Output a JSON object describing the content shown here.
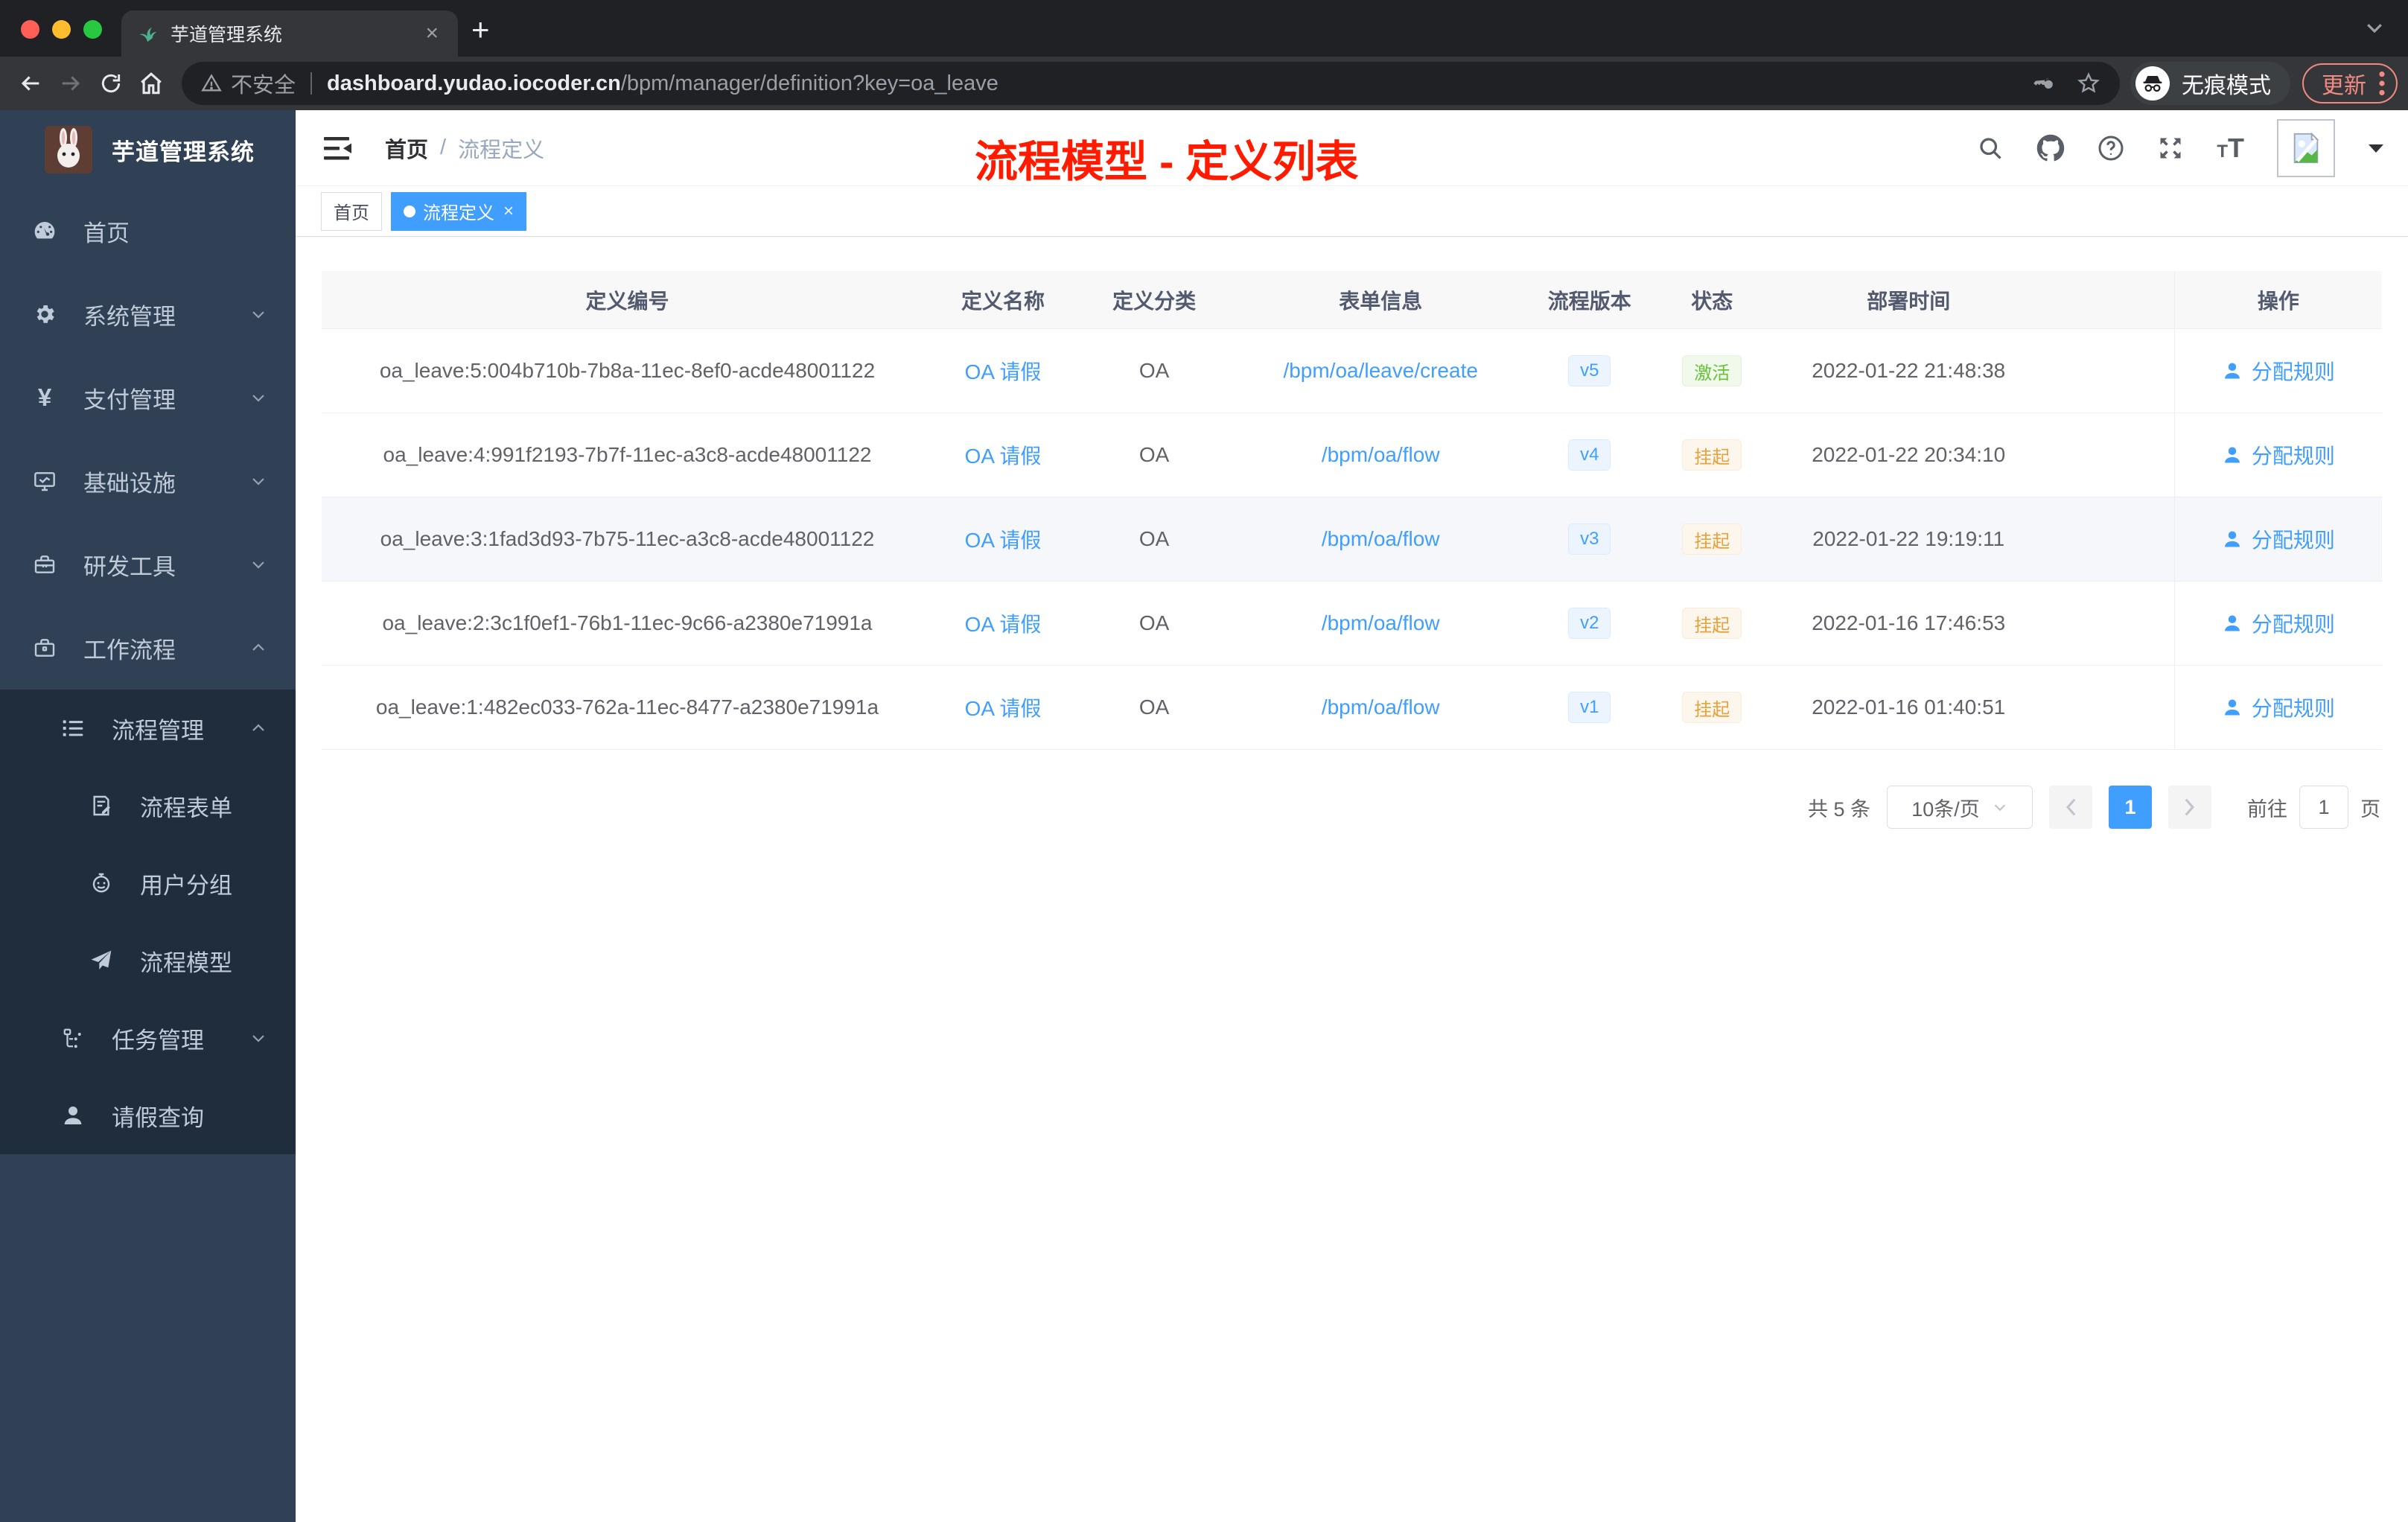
{
  "browser": {
    "tab_title": "芋道管理系统",
    "tab_close": "×",
    "new_tab": "+",
    "security_label": "不安全",
    "url_domain": "dashboard.yudao.iocoder.cn",
    "url_path": "/bpm/manager/definition?key=oa_leave",
    "incognito_label": "无痕模式",
    "update_label": "更新"
  },
  "sidebar": {
    "logo_title": "芋道管理系统",
    "menu": [
      {
        "key": "home",
        "label": "首页",
        "icon": "dashboard-icon",
        "level": 1
      },
      {
        "key": "system-mgmt",
        "label": "系统管理",
        "icon": "gear-icon",
        "level": 1,
        "chevron": "down"
      },
      {
        "key": "payment-mgmt",
        "label": "支付管理",
        "icon": "yen-icon",
        "level": 1,
        "chevron": "down"
      },
      {
        "key": "infrastructure",
        "label": "基础设施",
        "icon": "monitor-icon",
        "level": 1,
        "chevron": "down"
      },
      {
        "key": "dev-tools",
        "label": "研发工具",
        "icon": "toolbox-icon",
        "level": 1,
        "chevron": "down"
      },
      {
        "key": "workflow",
        "label": "工作流程",
        "icon": "briefcase-icon",
        "level": 1,
        "chevron": "up"
      }
    ],
    "submenu": [
      {
        "key": "process-mgmt",
        "label": "流程管理",
        "icon": "list-icon",
        "level": 2,
        "chevron": "up"
      },
      {
        "key": "process-form",
        "label": "流程表单",
        "icon": "form-icon",
        "level": 3
      },
      {
        "key": "user-group",
        "label": "用户分组",
        "icon": "robot-icon",
        "level": 3
      },
      {
        "key": "process-model",
        "label": "流程模型",
        "icon": "paper-plane-icon",
        "level": 3
      },
      {
        "key": "task-mgmt",
        "label": "任务管理",
        "icon": "tree-icon",
        "level": 2,
        "chevron": "down"
      },
      {
        "key": "leave-query",
        "label": "请假查询",
        "icon": "user-icon",
        "level": 2
      }
    ]
  },
  "header": {
    "breadcrumb": [
      "首页",
      "流程定义"
    ],
    "separator": "/",
    "annotation": "流程模型 - 定义列表"
  },
  "tags": [
    {
      "key": "home",
      "label": "首页",
      "active": false,
      "closable": false
    },
    {
      "key": "process-definition",
      "label": "流程定义",
      "active": true,
      "closable": true
    }
  ],
  "table": {
    "columns": [
      "定义编号",
      "定义名称",
      "定义分类",
      "表单信息",
      "流程版本",
      "状态",
      "部署时间",
      "操作"
    ],
    "rows": [
      {
        "id": "oa_leave:5:004b710b-7b8a-11ec-8ef0-acde48001122",
        "name": "OA 请假",
        "category": "OA",
        "form": "/bpm/oa/leave/create",
        "version": "v5",
        "status": "激活",
        "status_type": "success",
        "deploy_time": "2022-01-22 21:48:38",
        "action": "分配规则",
        "highlighted": false
      },
      {
        "id": "oa_leave:4:991f2193-7b7f-11ec-a3c8-acde48001122",
        "name": "OA 请假",
        "category": "OA",
        "form": "/bpm/oa/flow",
        "version": "v4",
        "status": "挂起",
        "status_type": "warning",
        "deploy_time": "2022-01-22 20:34:10",
        "action": "分配规则",
        "highlighted": false
      },
      {
        "id": "oa_leave:3:1fad3d93-7b75-11ec-a3c8-acde48001122",
        "name": "OA 请假",
        "category": "OA",
        "form": "/bpm/oa/flow",
        "version": "v3",
        "status": "挂起",
        "status_type": "warning",
        "deploy_time": "2022-01-22 19:19:11",
        "action": "分配规则",
        "highlighted": true
      },
      {
        "id": "oa_leave:2:3c1f0ef1-76b1-11ec-9c66-a2380e71991a",
        "name": "OA 请假",
        "category": "OA",
        "form": "/bpm/oa/flow",
        "version": "v2",
        "status": "挂起",
        "status_type": "warning",
        "deploy_time": "2022-01-16 17:46:53",
        "action": "分配规则",
        "highlighted": false
      },
      {
        "id": "oa_leave:1:482ec033-762a-11ec-8477-a2380e71991a",
        "name": "OA 请假",
        "category": "OA",
        "form": "/bpm/oa/flow",
        "version": "v1",
        "status": "挂起",
        "status_type": "warning",
        "deploy_time": "2022-01-16 01:40:51",
        "action": "分配规则",
        "highlighted": false
      }
    ]
  },
  "pagination": {
    "total_label": "共 5 条",
    "page_size_label": "10条/页",
    "current_page": "1",
    "goto_label": "前往",
    "goto_value": "1",
    "page_suffix": "页"
  },
  "colors": {
    "accent": "#409eff",
    "success": "#67c23a",
    "warning": "#e6a23c",
    "annotation_red": "#fe1b00",
    "sidebar_bg": "#304156",
    "submenu_bg": "#1f2d3d"
  }
}
